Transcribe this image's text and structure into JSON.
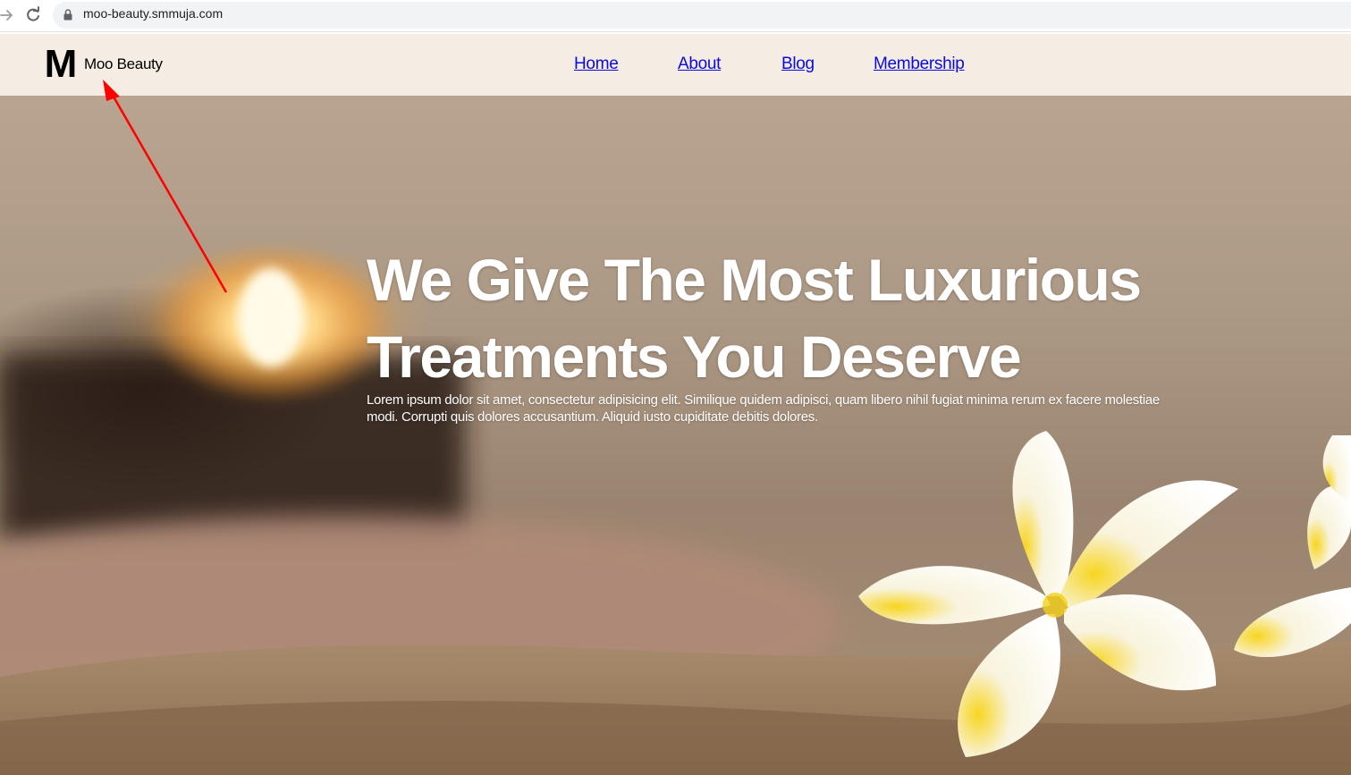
{
  "browser": {
    "url": "moo-beauty.smmuja.com"
  },
  "header": {
    "logo_letter": "M",
    "brand_name": "Moo Beauty",
    "nav": {
      "home": "Home",
      "about": "About",
      "blog": "Blog",
      "membership": "Membership"
    },
    "link_color": "#0a0ae0",
    "background_color": "#f5ede4"
  },
  "hero": {
    "title_line1": "We Give The Most Luxurious",
    "title_line2": "Treatments You Deserve",
    "text": "Lorem ipsum dolor sit amet, consectetur adipisicing elit. Similique quidem adipisci, quam libero nihil fugiat minima rerum ex facere molestiae modi. Corrupti quis dolores accusantium. Aliquid iusto cupiditate debitis dolores."
  },
  "annotation": {
    "type": "arrow",
    "color": "#ff0000",
    "points_to": "brand-name"
  }
}
